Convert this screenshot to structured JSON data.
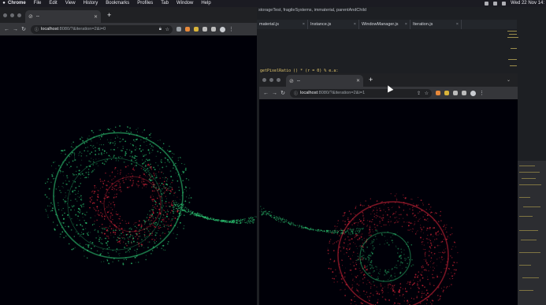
{
  "menubar": {
    "app_name": "Chrome",
    "items": [
      "File",
      "Edit",
      "View",
      "History",
      "Bookmarks",
      "Profiles",
      "Tab",
      "Window",
      "Help"
    ],
    "clock": "Wed 22 Nov 14:"
  },
  "editor": {
    "breadcrumb": "storageTest, fragileSystems, immaterial, parentAndChild",
    "tabs": [
      "material.js",
      "Instance.js",
      "WindowManager.js",
      "Iteration.js"
    ],
    "code_snippet": "getPixelRatio () * (r = 0) % e.a:"
  },
  "left_window": {
    "tab_title": "--",
    "url_host": "localhost",
    "url_path": ":8080/?&iteration=2&i=0"
  },
  "right_window": {
    "tab_title": "--",
    "url_host": "localhost",
    "url_path": ":8080/?&iteration=2&i=1"
  },
  "icons": {
    "menubar": [
      "apple-icon",
      "wifi-icon",
      "battery-icon",
      "control-center-icon"
    ],
    "browser": [
      "back-icon",
      "forward-icon",
      "reload-icon",
      "lock-icon",
      "star-icon",
      "share-icon",
      "extension-icon",
      "profile-icon",
      "menu-icon"
    ]
  },
  "colors": {
    "particle_green": "#2fd27a",
    "particle_red": "#d8253a",
    "canvas_bg": "#000008",
    "chrome_toolbar": "#35363a",
    "editor_bg": "#1d1f23"
  }
}
